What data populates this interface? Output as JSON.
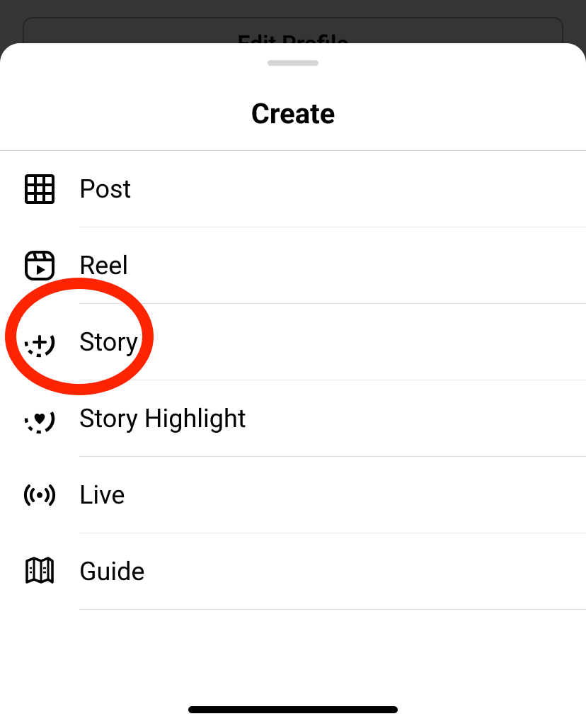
{
  "background": {
    "edit_profile_label": "Edit Profile"
  },
  "sheet": {
    "title": "Create",
    "items": [
      {
        "label": "Post"
      },
      {
        "label": "Reel"
      },
      {
        "label": "Story"
      },
      {
        "label": "Story Highlight"
      },
      {
        "label": "Live"
      },
      {
        "label": "Guide"
      }
    ]
  },
  "annotation": {
    "target_item_index": 2,
    "color": "#ff2400"
  }
}
